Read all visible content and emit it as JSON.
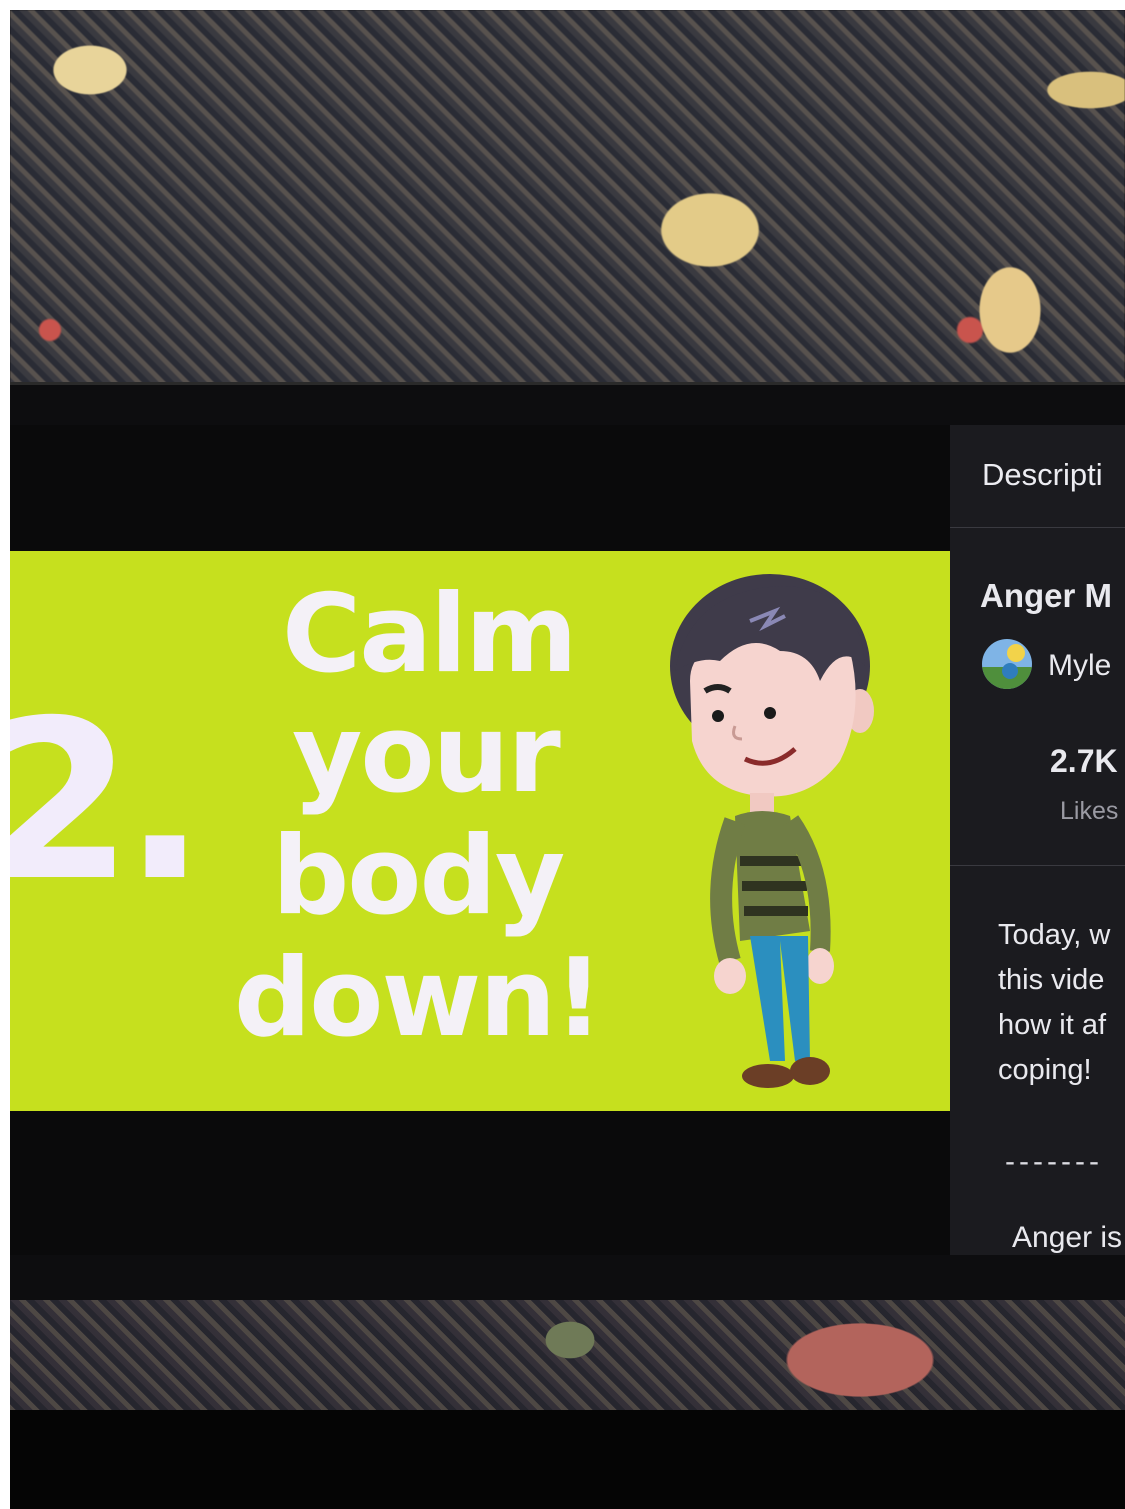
{
  "video": {
    "step_number": "2.",
    "headline": [
      "Calm",
      "your",
      "body",
      "down!"
    ],
    "background_color": "#c6e01e",
    "text_color": "#f4f1f7"
  },
  "description_panel": {
    "header": "Descripti",
    "title": "Anger M",
    "channel_avatar_icon": "channel-avatar",
    "channel_name": "Myle",
    "likes_count": "2.7K",
    "likes_label": "Likes",
    "text_lines": [
      "Today, w",
      "this vide",
      "how it af",
      "coping!"
    ],
    "separator": "-------",
    "next_paragraph": "Anger is"
  }
}
